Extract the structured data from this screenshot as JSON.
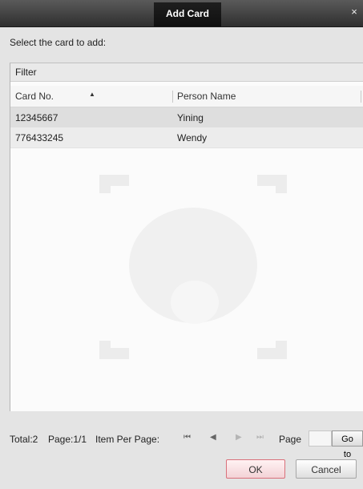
{
  "dialog": {
    "title": "Add Card",
    "close_glyph": "×",
    "prompt": "Select the card to add:"
  },
  "filter": {
    "label": "Filter"
  },
  "table": {
    "columns": [
      "Card No.",
      "Person Name"
    ],
    "rows": [
      {
        "card_no": "12345667",
        "person_name": "Yining"
      },
      {
        "card_no": "776433245",
        "person_name": "Wendy"
      }
    ]
  },
  "pagination": {
    "total_label": "Total:2",
    "page_label": "Page:1/1",
    "items_per_page_label": "Item Per Page:",
    "first_glyph": "⏮",
    "prev_glyph": "◀",
    "next_glyph": "▶",
    "last_glyph": "⏭",
    "page_field_label": "Page",
    "page_input_value": "",
    "goto_label": "Go to"
  },
  "buttons": {
    "ok": "OK",
    "cancel": "Cancel"
  },
  "colors": {
    "titlebar": "#3a3a3a",
    "selected_row": "#dedede",
    "ok_border": "#d9717b",
    "background": "#e4e4e4"
  },
  "icons": {
    "close": "close-icon",
    "first": "first-page-icon",
    "prev": "prev-page-icon",
    "next": "next-page-icon",
    "last": "last-page-icon"
  }
}
